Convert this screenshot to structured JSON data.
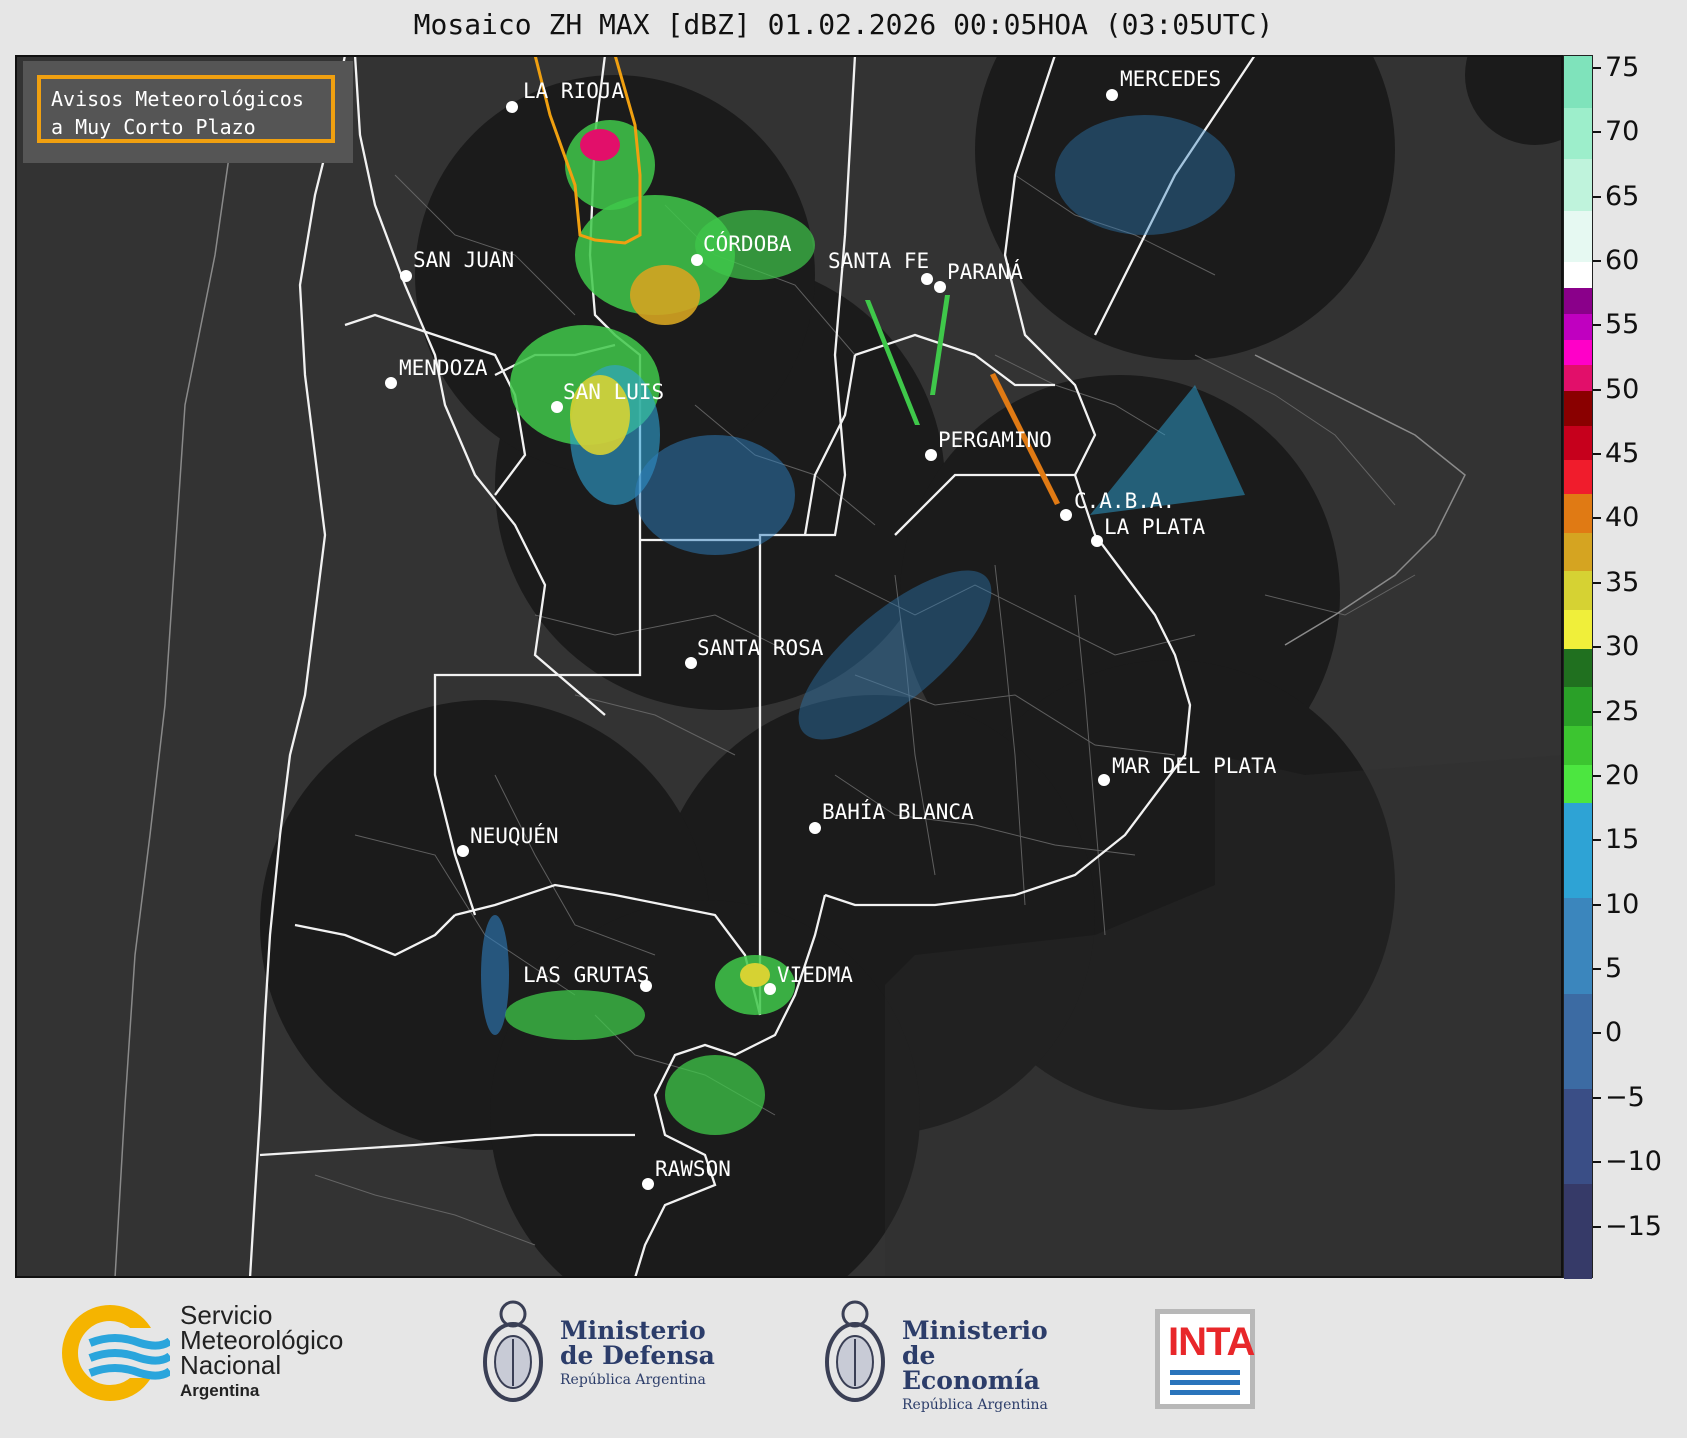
{
  "title": "Mosaico ZH MAX [dBZ] 01.02.2026 00:05HOA (03:05UTC)",
  "notice": {
    "line1": "Avisos Meteorológicos",
    "line2": "a Muy Corto Plazo",
    "border_color": "#f0a010"
  },
  "cities": [
    "LA RIOJA",
    "MERCEDES",
    "CÓRDOBA",
    "SAN JUAN",
    "SANTA FE",
    "PARANÁ",
    "MENDOZA",
    "SAN LUIS",
    "PERGAMINO",
    "C.A.B.A.",
    "LA PLATA",
    "SANTA ROSA",
    "MAR DEL PLATA",
    "BAHÍA BLANCA",
    "NEUQUÉN",
    "LAS GRUTAS",
    "VIEDMA",
    "RAWSON"
  ],
  "colorbar": {
    "ticks": [
      "75",
      "70",
      "65",
      "60",
      "55",
      "50",
      "45",
      "40",
      "35",
      "30",
      "25",
      "20",
      "15",
      "10",
      "5",
      "0",
      "−5",
      "−10",
      "−15"
    ],
    "vmin": -19,
    "vmax": 76,
    "stops": [
      {
        "from": -19,
        "to": 18,
        "colors": [
          "#363a68",
          "#3a4e86",
          "#3c6ba3",
          "#3b86bd",
          "#2ea3d5"
        ]
      },
      {
        "from": 18,
        "to": 30,
        "colors": [
          "#4ce640",
          "#3cc530",
          "#2aa028",
          "#20701f"
        ]
      },
      {
        "from": 30,
        "to": 42,
        "colors": [
          "#f0ef3a",
          "#d6d233",
          "#d5a421",
          "#e07a14"
        ]
      },
      {
        "from": 42,
        "to": 50,
        "colors": [
          "#f01c2c",
          "#c6001c",
          "#8a0000"
        ]
      },
      {
        "from": 50,
        "to": 58,
        "colors": [
          "#e20f6a",
          "#ff00c8",
          "#c000c0",
          "#8a008a"
        ]
      },
      {
        "from": 58,
        "to": 60,
        "colors": [
          "#ffffff"
        ]
      },
      {
        "from": 60,
        "to": 76,
        "colors": [
          "#e6f9f2",
          "#bff3dc",
          "#9deecb",
          "#7fe3bb"
        ]
      }
    ]
  },
  "footer": {
    "smn": {
      "line1": "Servicio",
      "line2": "Meteorológico",
      "line3": "Nacional",
      "line4": "Argentina"
    },
    "defensa": {
      "line1": "Ministerio",
      "line2": "de Defensa",
      "line3": "República Argentina"
    },
    "economia": {
      "line1": "Ministerio",
      "line2": "de Economía",
      "line3": "República Argentina"
    },
    "inta": "INTA"
  }
}
